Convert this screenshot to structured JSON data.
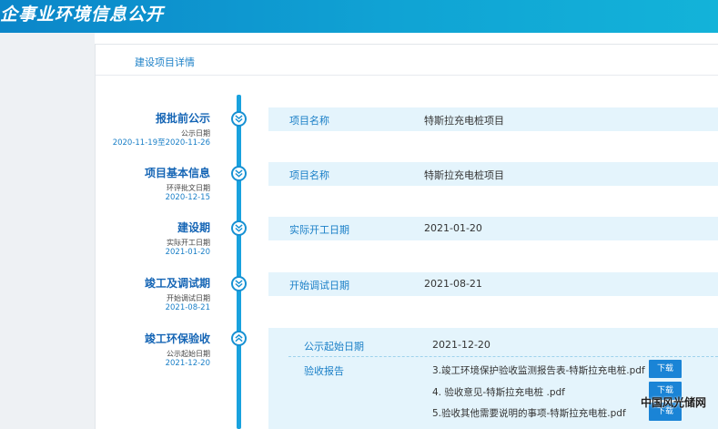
{
  "header": {
    "title": "企事业环境信息公开"
  },
  "breadcrumb": {
    "label": "建设项目详情"
  },
  "stages": [
    {
      "name": "报批前公示",
      "sub": "公示日期",
      "date": "2020-11-19至2020-11-26"
    },
    {
      "name": "项目基本信息",
      "sub": "环评批文日期",
      "date": "2020-12-15"
    },
    {
      "name": "建设期",
      "sub": "实际开工日期",
      "date": "2021-01-20"
    },
    {
      "name": "竣工及调试期",
      "sub": "开始调试日期",
      "date": "2021-08-21"
    },
    {
      "name": "竣工环保验收",
      "sub": "公示起始日期",
      "date": "2021-12-20"
    }
  ],
  "rows": [
    {
      "key": "项目名称",
      "value": "特斯拉充电桩项目"
    },
    {
      "key": "项目名称",
      "value": "特斯拉充电桩项目"
    },
    {
      "key": "实际开工日期",
      "value": "2021-01-20"
    },
    {
      "key": "开始调试日期",
      "value": "2021-08-21"
    }
  ],
  "acceptance": {
    "start_key": "公示起始日期",
    "start_value": "2021-12-20",
    "report_key": "验收报告",
    "files": [
      "3.竣工环境保护验收监测报告表-特斯拉充电桩.pdf",
      "4. 验收意见-特斯拉充电桩 .pdf",
      "5.验收其他需要说明的事项-特斯拉充电桩.pdf"
    ],
    "download_label": "下载"
  },
  "watermark": "中国风光储网"
}
